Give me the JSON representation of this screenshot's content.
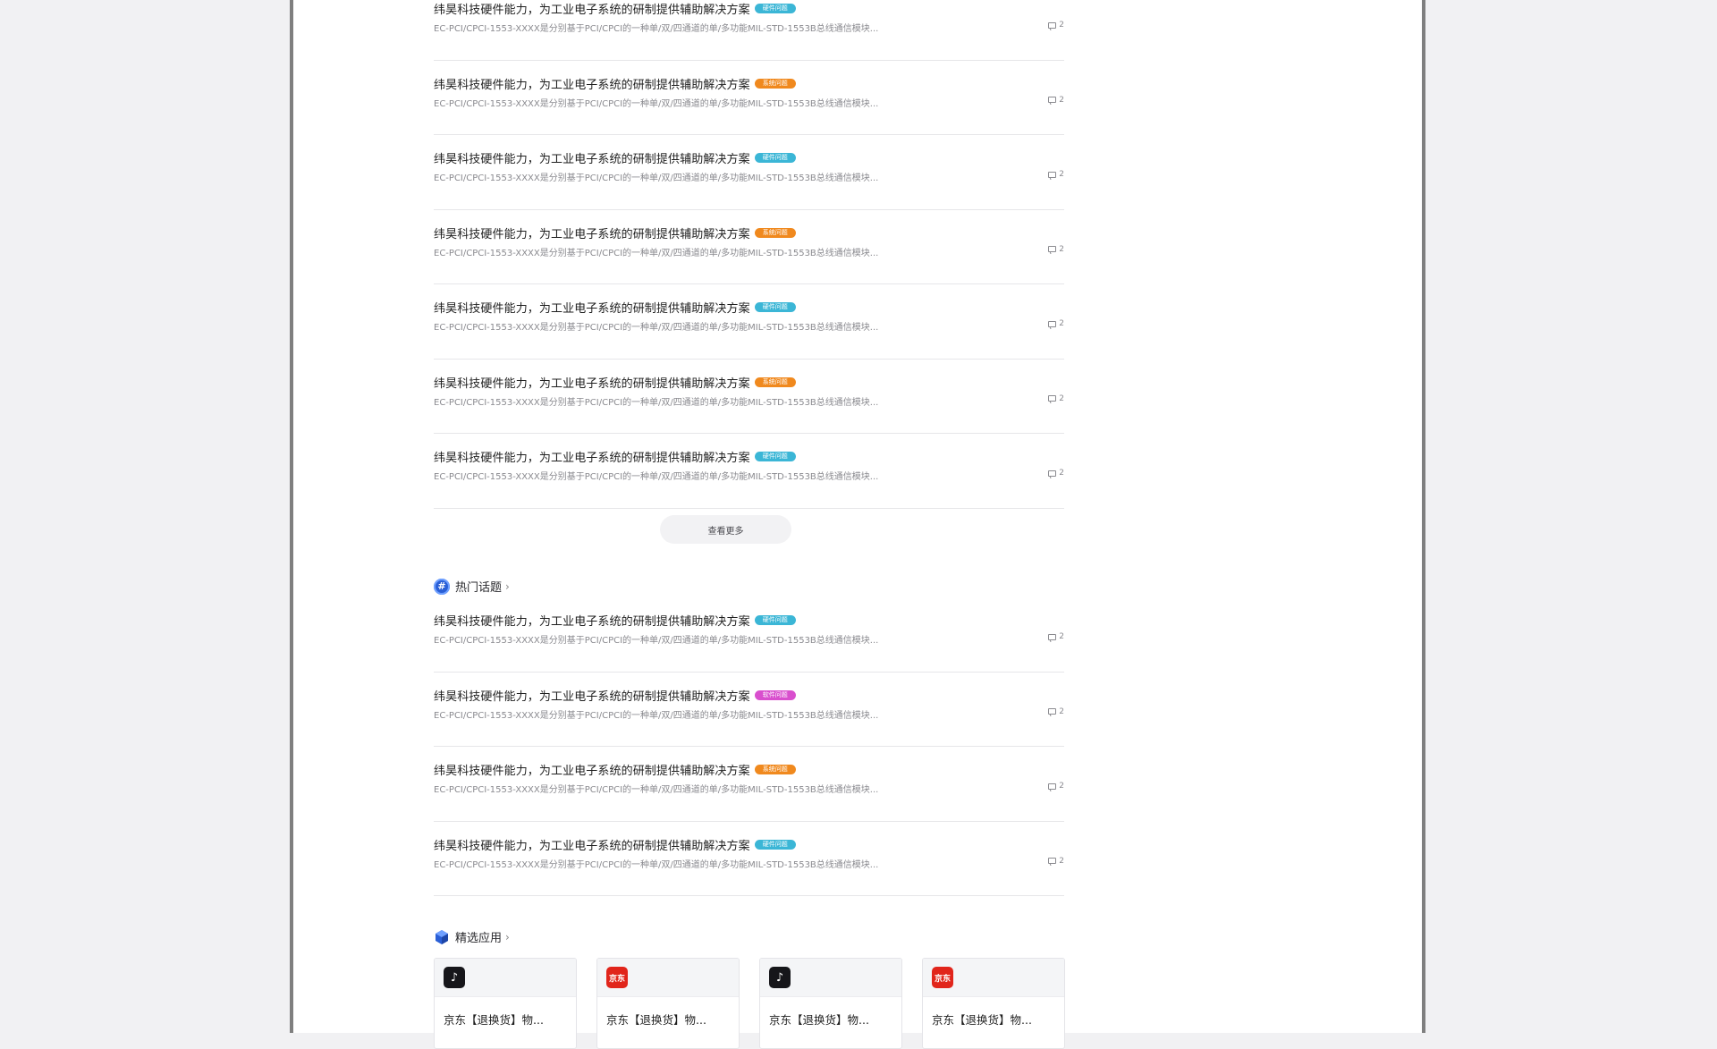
{
  "colors": {
    "tag_blue": "#3bb6d6",
    "tag_orange": "#f0891e",
    "tag_purple": "#d94fce"
  },
  "top_list": [
    {
      "title": "纬昊科技硬件能力，为工业电子系统的研制提供辅助解决方案",
      "tag": "硬件问题",
      "tag_color": "#3bb6d6",
      "desc": "EC-PCI/CPCI-1553-XXXX是分别基于PCI/CPCI的一种单/双/四通道的单/多功能MIL-STD-1553B总线通信模块...",
      "count": "2"
    },
    {
      "title": "纬昊科技硬件能力，为工业电子系统的研制提供辅助解决方案",
      "tag": "系统问题",
      "tag_color": "#f0891e",
      "desc": "EC-PCI/CPCI-1553-XXXX是分别基于PCI/CPCI的一种单/双/四通道的单/多功能MIL-STD-1553B总线通信模块...",
      "count": "2"
    },
    {
      "title": "纬昊科技硬件能力，为工业电子系统的研制提供辅助解决方案",
      "tag": "硬件问题",
      "tag_color": "#3bb6d6",
      "desc": "EC-PCI/CPCI-1553-XXXX是分别基于PCI/CPCI的一种单/双/四通道的单/多功能MIL-STD-1553B总线通信模块...",
      "count": "2"
    },
    {
      "title": "纬昊科技硬件能力，为工业电子系统的研制提供辅助解决方案",
      "tag": "系统问题",
      "tag_color": "#f0891e",
      "desc": "EC-PCI/CPCI-1553-XXXX是分别基于PCI/CPCI的一种单/双/四通道的单/多功能MIL-STD-1553B总线通信模块...",
      "count": "2"
    },
    {
      "title": "纬昊科技硬件能力，为工业电子系统的研制提供辅助解决方案",
      "tag": "硬件问题",
      "tag_color": "#3bb6d6",
      "desc": "EC-PCI/CPCI-1553-XXXX是分别基于PCI/CPCI的一种单/双/四通道的单/多功能MIL-STD-1553B总线通信模块...",
      "count": "2"
    },
    {
      "title": "纬昊科技硬件能力，为工业电子系统的研制提供辅助解决方案",
      "tag": "系统问题",
      "tag_color": "#f0891e",
      "desc": "EC-PCI/CPCI-1553-XXXX是分别基于PCI/CPCI的一种单/双/四通道的单/多功能MIL-STD-1553B总线通信模块...",
      "count": "2"
    },
    {
      "title": "纬昊科技硬件能力，为工业电子系统的研制提供辅助解决方案",
      "tag": "硬件问题",
      "tag_color": "#3bb6d6",
      "desc": "EC-PCI/CPCI-1553-XXXX是分别基于PCI/CPCI的一种单/双/四通道的单/多功能MIL-STD-1553B总线通信模块...",
      "count": "2"
    }
  ],
  "more_button_label": "查看更多",
  "hot_section": {
    "icon": "hash-icon",
    "icon_glyph": "#",
    "title": "热门话题",
    "chevron": "›"
  },
  "hot_list": [
    {
      "title": "纬昊科技硬件能力，为工业电子系统的研制提供辅助解决方案",
      "tag": "硬件问题",
      "tag_color": "#3bb6d6",
      "desc": "EC-PCI/CPCI-1553-XXXX是分别基于PCI/CPCI的一种单/双/四通道的单/多功能MIL-STD-1553B总线通信模块...",
      "count": "2"
    },
    {
      "title": "纬昊科技硬件能力，为工业电子系统的研制提供辅助解决方案",
      "tag": "软件问题",
      "tag_color": "#d94fce",
      "desc": "EC-PCI/CPCI-1553-XXXX是分别基于PCI/CPCI的一种单/双/四通道的单/多功能MIL-STD-1553B总线通信模块...",
      "count": "2"
    },
    {
      "title": "纬昊科技硬件能力，为工业电子系统的研制提供辅助解决方案",
      "tag": "系统问题",
      "tag_color": "#f0891e",
      "desc": "EC-PCI/CPCI-1553-XXXX是分别基于PCI/CPCI的一种单/双/四通道的单/多功能MIL-STD-1553B总线通信模块...",
      "count": "2"
    },
    {
      "title": "纬昊科技硬件能力，为工业电子系统的研制提供辅助解决方案",
      "tag": "硬件问题",
      "tag_color": "#3bb6d6",
      "desc": "EC-PCI/CPCI-1553-XXXX是分别基于PCI/CPCI的一种单/双/四通道的单/多功能MIL-STD-1553B总线通信模块...",
      "count": "2"
    }
  ],
  "apps_section": {
    "icon": "cube-icon",
    "title": "精选应用",
    "chevron": "›"
  },
  "apps": [
    {
      "name": "京东【退换货】物...",
      "logo": "tiktok-icon",
      "logo_glyph": "♪"
    },
    {
      "name": "京东【退换货】物...",
      "logo": "jd-icon",
      "logo_glyph": "京东"
    },
    {
      "name": "京东【退换货】物...",
      "logo": "tiktok-icon",
      "logo_glyph": "♪"
    },
    {
      "name": "京东【退换货】物...",
      "logo": "jd-icon",
      "logo_glyph": "京东"
    }
  ]
}
